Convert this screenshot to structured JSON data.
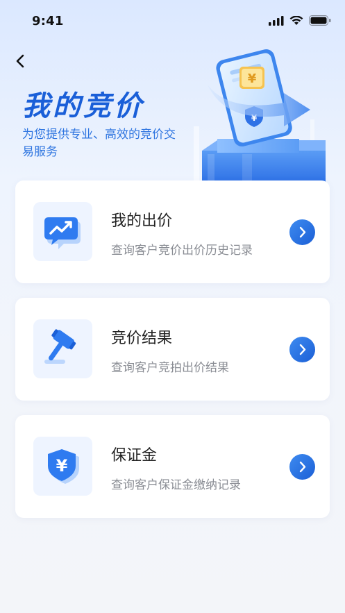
{
  "status_bar": {
    "time": "9:41"
  },
  "header": {
    "title": "我的竞价",
    "subtitle": "为您提供专业、高效的竞价交易服务"
  },
  "cards": [
    {
      "title": "我的出价",
      "desc": "查询客户竞价出价历史记录",
      "icon": "chart-chat-icon"
    },
    {
      "title": "竞价结果",
      "desc": "查询客户竞拍出价结果",
      "icon": "gavel-icon"
    },
    {
      "title": "保证金",
      "desc": "查询客户保证金缴纳记录",
      "icon": "yuan-shield-icon"
    }
  ],
  "colors": {
    "accent": "#1b5fd6",
    "title": "#1a5fd8",
    "icon_bg": "#eef4ff"
  }
}
